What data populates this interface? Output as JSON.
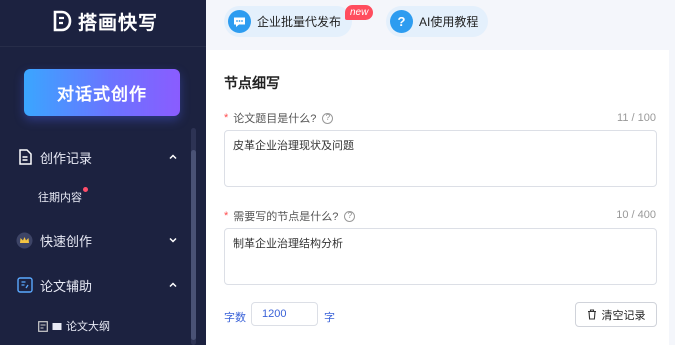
{
  "app": {
    "title": "搭画快写"
  },
  "sidebar": {
    "create_button": "对话式创作",
    "items": [
      {
        "label": "创作记录",
        "icon": "document-icon"
      },
      {
        "label": "快速创作",
        "icon": "crown-icon"
      },
      {
        "label": "论文辅助",
        "icon": "paper-assist-icon"
      }
    ],
    "sub_items": {
      "history": "往期内容",
      "outline": "论文大纲"
    }
  },
  "topbar": {
    "batch_publish": "企业批量代发布",
    "new_badge": "new",
    "ai_tutorial": "AI使用教程"
  },
  "main": {
    "section_title": "节点细写",
    "fields": [
      {
        "label": "论文题目是什么?",
        "counter": "11 / 100",
        "value": "皮革企业治理现状及问题"
      },
      {
        "label": "需要写的节点是什么?",
        "counter": "10 / 400",
        "value": "制革企业治理结构分析"
      }
    ],
    "word_count_label": "字数",
    "word_count_value": "1200",
    "word_count_unit": "字",
    "clear_button": "清空记录"
  },
  "colors": {
    "sidebar_bg": "#1c2240",
    "accent_blue": "#2d9cf0",
    "badge_red": "#ff4d5e",
    "link_blue": "#3a62d8"
  }
}
